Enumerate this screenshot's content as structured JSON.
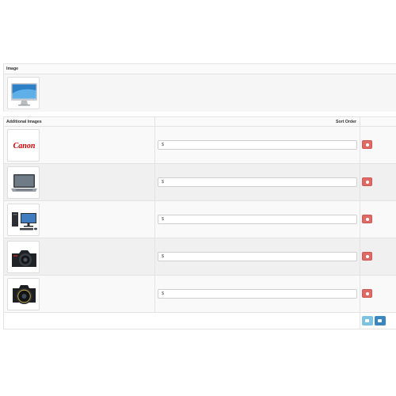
{
  "image_section": {
    "header": "Image",
    "image_icon": "monitor-icon"
  },
  "additional_images": {
    "header_images": "Additional Images",
    "header_sort": "Sort Order",
    "rows": [
      {
        "icon": "canon-logo-icon",
        "brand_text": "Canon",
        "sort_value": "$"
      },
      {
        "icon": "laptop-icon",
        "sort_value": "$"
      },
      {
        "icon": "desktop-computer-icon",
        "sort_value": "$"
      },
      {
        "icon": "camera-icon",
        "sort_value": "$"
      },
      {
        "icon": "camera-lens-icon",
        "sort_value": "$"
      }
    ]
  },
  "footer": {
    "button_1_icon": "image-icon",
    "button_2_icon": "plus-icon"
  },
  "colors": {
    "delete": "#de6a65",
    "primary": "#3a87bf",
    "info": "#7dc2e0",
    "canon_red": "#cc0000"
  }
}
